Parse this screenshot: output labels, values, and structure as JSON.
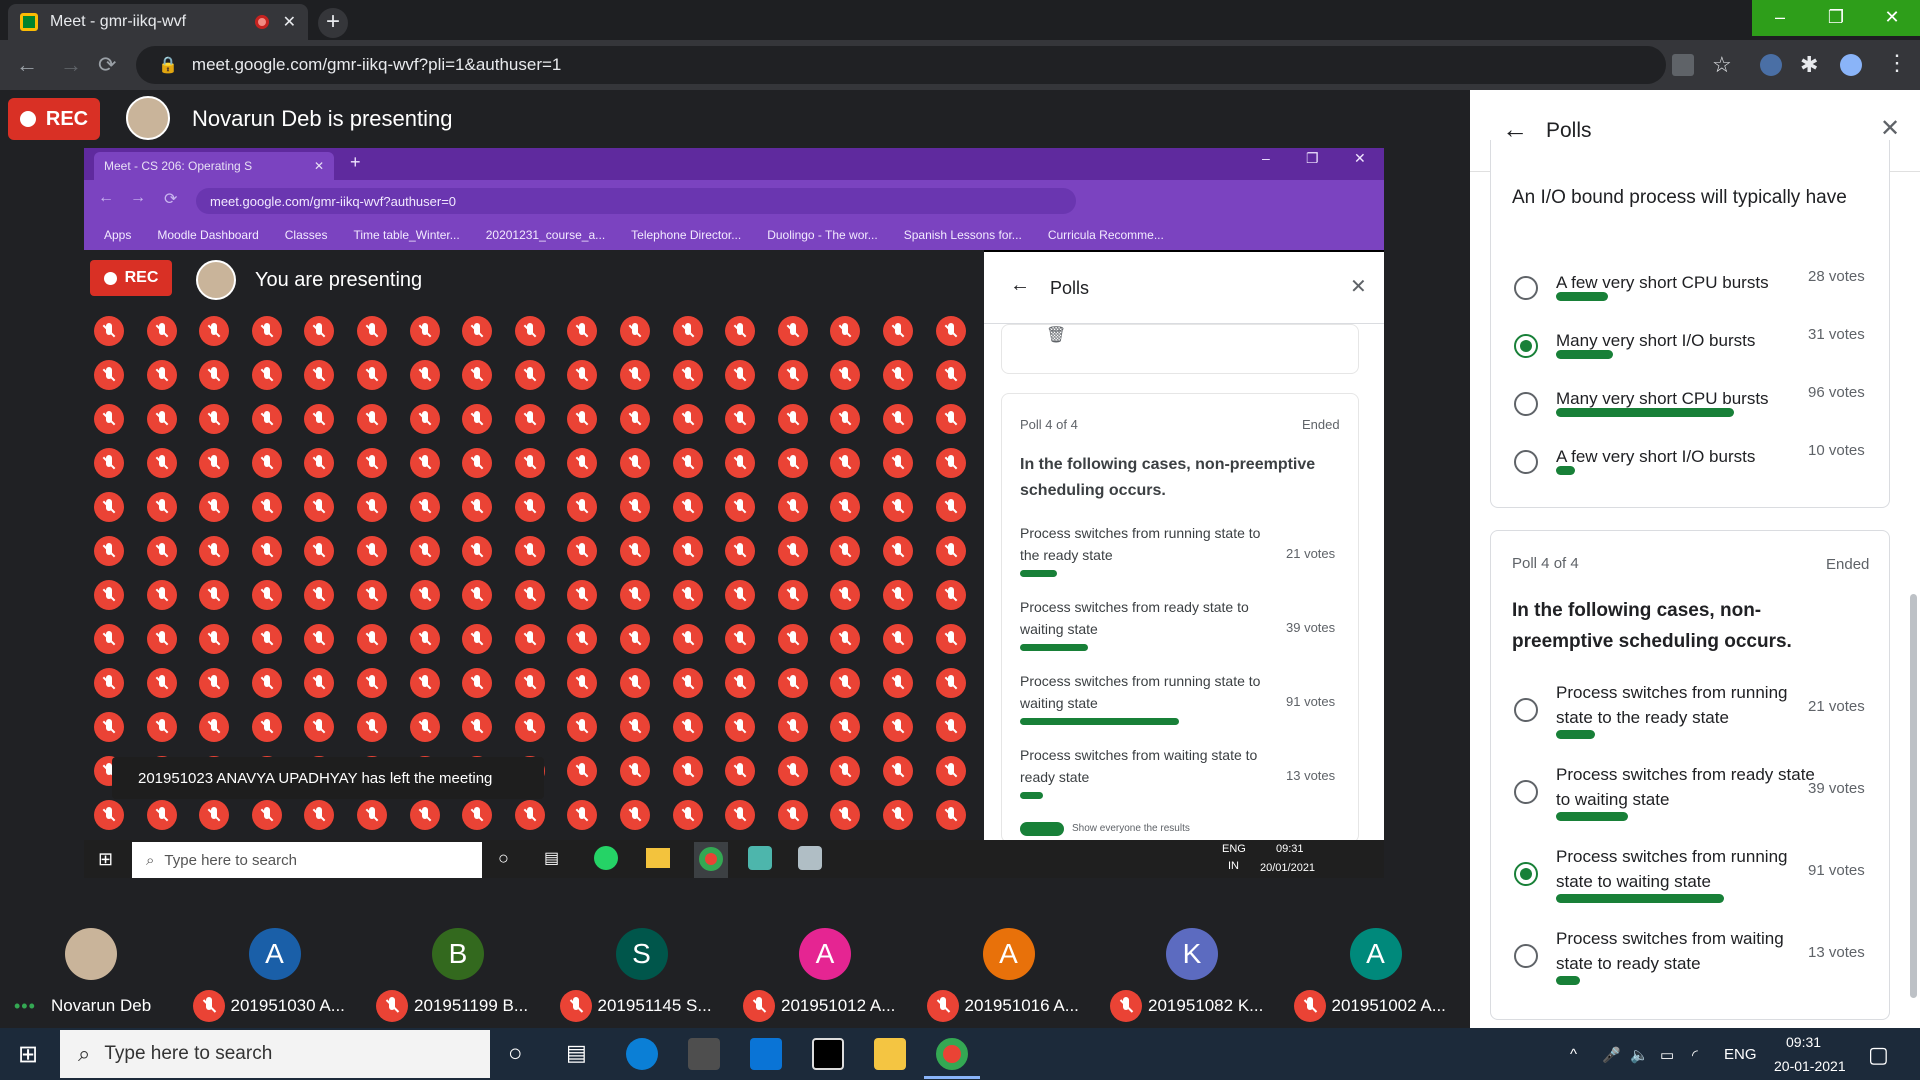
{
  "browser": {
    "tab_title": "Meet - gmr-iikq-wvf",
    "url": "meet.google.com/gmr-iikq-wvf?pli=1&authuser=1"
  },
  "meet": {
    "rec_label": "REC",
    "presenting_text": "Novarun Deb is presenting"
  },
  "shared_screen": {
    "tab_title": "Meet - CS 206: Operating S",
    "url": "meet.google.com/gmr-iikq-wvf?authuser=0",
    "bookmarks": [
      "Apps",
      "Moodle Dashboard",
      "Classes",
      "Time table_Winter...",
      "20201231_course_a...",
      "Telephone Director...",
      "Duolingo - The wor...",
      "Spanish Lessons for...",
      "Curricula Recomme..."
    ],
    "rec_label": "REC",
    "presenting_text": "You are presenting",
    "toast": "201951023 ANAVYA UPADHYAY has left the meeting",
    "polls": {
      "title": "Polls",
      "poll_counter": "Poll 4 of 4",
      "status": "Ended",
      "question": "In the following cases, non-preemptive scheduling occurs.",
      "options": [
        {
          "text": "Process switches from running state to the ready state",
          "votes": "21 votes",
          "share": 0.21
        },
        {
          "text": "Process switches from ready state to waiting state",
          "votes": "39 votes",
          "share": 0.39
        },
        {
          "text": "Process switches from running state to waiting state",
          "votes": "91 votes",
          "share": 0.91
        },
        {
          "text": "Process switches from waiting state to ready state",
          "votes": "13 votes",
          "share": 0.13
        }
      ],
      "footer": "Show everyone the results"
    },
    "taskbar": {
      "search": "Type here to search",
      "lang": "ENG",
      "region": "IN",
      "time": "09:31",
      "date": "20/01/2021"
    }
  },
  "polls_panel": {
    "title": "Polls",
    "poll1": {
      "question": "An I/O bound process will typically have",
      "options": [
        {
          "text": "A few very short CPU bursts",
          "votes": "28 votes",
          "share": 0.28,
          "selected": false
        },
        {
          "text": "Many very short I/O bursts",
          "votes": "31 votes",
          "share": 0.31,
          "selected": true
        },
        {
          "text": "Many very short CPU bursts",
          "votes": "96 votes",
          "share": 0.96,
          "selected": false
        },
        {
          "text": "A few very short I/O bursts",
          "votes": "10 votes",
          "share": 0.1,
          "selected": false
        }
      ]
    },
    "poll2": {
      "counter": "Poll 4 of 4",
      "status": "Ended",
      "question": "In the following cases, non-preemptive scheduling occurs.",
      "options": [
        {
          "text": "Process switches from running state to the ready state",
          "votes": "21 votes",
          "share": 0.21,
          "selected": false
        },
        {
          "text": "Process switches from ready state to waiting state",
          "votes": "39 votes",
          "share": 0.39,
          "selected": false
        },
        {
          "text": "Process switches from running state to waiting state",
          "votes": "91 votes",
          "share": 0.91,
          "selected": true
        },
        {
          "text": "Process switches from waiting state to ready state",
          "votes": "13 votes",
          "share": 0.13,
          "selected": false
        }
      ]
    }
  },
  "participants": [
    {
      "initial": "",
      "name": "Novarun Deb",
      "color": "#c9b49a"
    },
    {
      "initial": "A",
      "name": "201951030 A...",
      "color": "#1a5fa8"
    },
    {
      "initial": "B",
      "name": "201951199 B...",
      "color": "#33691e"
    },
    {
      "initial": "S",
      "name": "201951145 S...",
      "color": "#00564b"
    },
    {
      "initial": "A",
      "name": "201951012 A...",
      "color": "#e52592"
    },
    {
      "initial": "A",
      "name": "201951016 A...",
      "color": "#e8710a"
    },
    {
      "initial": "K",
      "name": "201951082 K...",
      "color": "#5c6bc0"
    },
    {
      "initial": "A",
      "name": "201951002 A...",
      "color": "#00897b"
    }
  ],
  "taskbar": {
    "search": "Type here to search",
    "lang": "ENG",
    "time": "09:31",
    "date": "20-01-2021"
  },
  "colors": {
    "rec": "#d93025",
    "vote_bar": "#188038",
    "mic_off": "#ea4335",
    "accent": "#188038"
  }
}
